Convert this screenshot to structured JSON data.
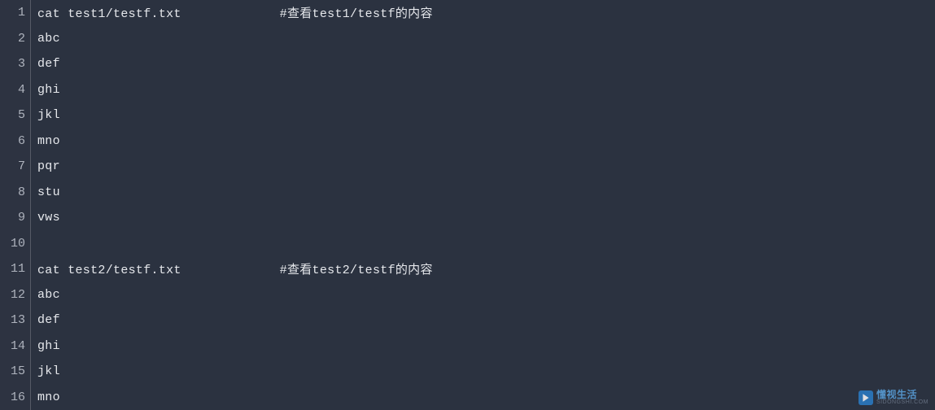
{
  "code": {
    "lines": [
      {
        "num": "1",
        "text": "cat test1/testf.txt             #查看test1/testf的内容"
      },
      {
        "num": "2",
        "text": "abc"
      },
      {
        "num": "3",
        "text": "def"
      },
      {
        "num": "4",
        "text": "ghi"
      },
      {
        "num": "5",
        "text": "jkl"
      },
      {
        "num": "6",
        "text": "mno"
      },
      {
        "num": "7",
        "text": "pqr"
      },
      {
        "num": "8",
        "text": "stu"
      },
      {
        "num": "9",
        "text": "vws"
      },
      {
        "num": "10",
        "text": ""
      },
      {
        "num": "11",
        "text": "cat test2/testf.txt             #查看test2/testf的内容"
      },
      {
        "num": "12",
        "text": "abc"
      },
      {
        "num": "13",
        "text": "def"
      },
      {
        "num": "14",
        "text": "ghi"
      },
      {
        "num": "15",
        "text": "jkl"
      },
      {
        "num": "16",
        "text": "mno"
      }
    ]
  },
  "watermark": {
    "brand": "懂视生活",
    "domain": "SIDONGSHI.COM"
  }
}
